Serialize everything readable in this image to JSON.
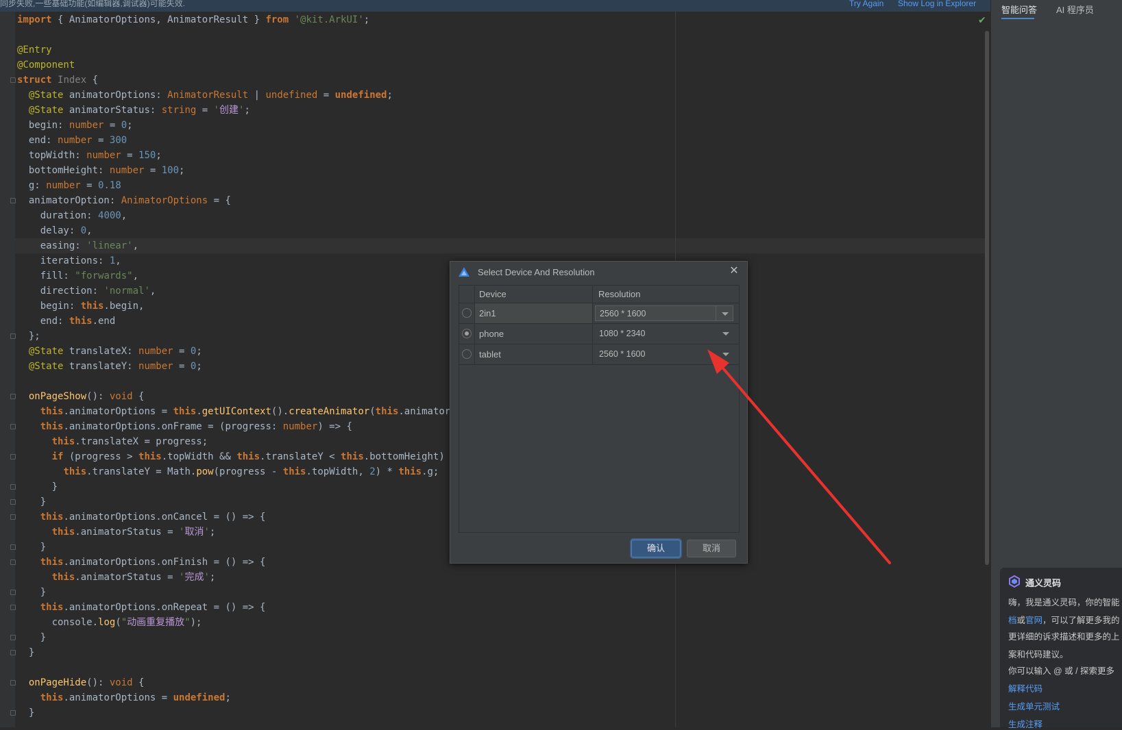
{
  "notification": {
    "text": "同步失败,一些基础功能(如编辑器,调试器)可能失效.",
    "try_again": "Try Again",
    "show_log": "Show Log in Explorer"
  },
  "editor": {
    "status_icon": "check-icon",
    "lines": [
      {
        "row": 0,
        "html": "<span class='kw'>import</span> { AnimatorOptions, AnimatorResult } <span class='kw'>from</span> <span class='str'>'@kit.ArkUI'</span>;"
      },
      {
        "row": 2,
        "html": "<span class='deco'>@Entry</span>"
      },
      {
        "row": 3,
        "html": "<span class='deco'>@Component</span>"
      },
      {
        "row": 4,
        "html": "<span class='kw'>struct</span> <span class='gray'>Index</span> {"
      },
      {
        "row": 5,
        "html": "  <span class='deco'>@State</span> animatorOptions: <span class='type'>AnimatorResult</span> | <span class='kwn'>undefined</span> = <span class='kw'>undefined</span>;"
      },
      {
        "row": 6,
        "html": "  <span class='deco'>@State</span> animatorStatus: <span class='kwn'>string</span> = <span class='str'>'<span class=\"purple\">创建</span>'</span>;"
      },
      {
        "row": 7,
        "html": "  begin: <span class='kwn'>number</span> = <span class='num'>0</span>;"
      },
      {
        "row": 8,
        "html": "  end: <span class='kwn'>number</span> = <span class='num'>300</span>"
      },
      {
        "row": 9,
        "html": "  topWidth: <span class='kwn'>number</span> = <span class='num'>150</span>;"
      },
      {
        "row": 10,
        "html": "  bottomHeight: <span class='kwn'>number</span> = <span class='num'>100</span>;"
      },
      {
        "row": 11,
        "html": "  g: <span class='kwn'>number</span> = <span class='num'>0.18</span>"
      },
      {
        "row": 12,
        "html": "  animatorOption: <span class='type'>AnimatorOptions</span> = {"
      },
      {
        "row": 13,
        "html": "    duration: <span class='num'>4000</span>,"
      },
      {
        "row": 14,
        "html": "    delay: <span class='num'>0</span>,"
      },
      {
        "row": 15,
        "html": "    easing: <span class='str'>'linear'</span>,"
      },
      {
        "row": 16,
        "html": "    iterations: <span class='num'>1</span>,"
      },
      {
        "row": 17,
        "html": "    fill: <span class='str'>\"forwards\"</span>,"
      },
      {
        "row": 18,
        "html": "    direction: <span class='str'>'normal'</span>,"
      },
      {
        "row": 19,
        "html": "    begin: <span class='kw'>this</span>.begin,"
      },
      {
        "row": 20,
        "html": "    end: <span class='kw'>this</span>.end"
      },
      {
        "row": 21,
        "html": "  };"
      },
      {
        "row": 22,
        "html": "  <span class='deco'>@State</span> translateX: <span class='kwn'>number</span> = <span class='num'>0</span>;"
      },
      {
        "row": 23,
        "html": "  <span class='deco'>@State</span> translateY: <span class='kwn'>number</span> = <span class='num'>0</span>;"
      },
      {
        "row": 25,
        "html": "  <span class='fn'>onPageShow</span>(): <span class='kwn'>void</span> {"
      },
      {
        "row": 26,
        "html": "    <span class='kw'>this</span>.animatorOptions = <span class='kw'>this</span>.<span class='fn'>getUIContext</span>().<span class='fn'>createAnimator</span>(<span class='kw'>this</span>.animatorOpti"
      },
      {
        "row": 27,
        "html": "    <span class='kw'>this</span>.animatorOptions.onFrame = (progress: <span class='kwn'>number</span>) => {"
      },
      {
        "row": 28,
        "html": "      <span class='kw'>this</span>.translateX = progress;"
      },
      {
        "row": 29,
        "html": "      <span class='kw'>if</span> (progress > <span class='kw'>this</span>.topWidth && <span class='kw'>this</span>.translateY < <span class='kw'>this</span>.bottomHeight) {"
      },
      {
        "row": 30,
        "html": "        <span class='kw'>this</span>.translateY = Math.<span class='fn'>pow</span>(progress - <span class='kw'>this</span>.topWidth, <span class='num'>2</span>) * <span class='kw'>this</span>.g;"
      },
      {
        "row": 31,
        "html": "      }"
      },
      {
        "row": 32,
        "html": "    }"
      },
      {
        "row": 33,
        "html": "    <span class='kw'>this</span>.animatorOptions.onCancel = () => {"
      },
      {
        "row": 34,
        "html": "      <span class='kw'>this</span>.animatorStatus = <span class='str'>'<span class=\"purple\">取消</span>'</span>;"
      },
      {
        "row": 35,
        "html": "    }"
      },
      {
        "row": 36,
        "html": "    <span class='kw'>this</span>.animatorOptions.onFinish = () => {"
      },
      {
        "row": 37,
        "html": "      <span class='kw'>this</span>.animatorStatus = <span class='str'>'<span class=\"purple\">完成</span>'</span>;"
      },
      {
        "row": 38,
        "html": "    }"
      },
      {
        "row": 39,
        "html": "    <span class='kw'>this</span>.animatorOptions.onRepeat = () => {"
      },
      {
        "row": 40,
        "html": "      console.<span class='fn'>log</span>(<span class='str'>\"<span class=\"purple\">动画重复播放</span>\"</span>);"
      },
      {
        "row": 41,
        "html": "    }"
      },
      {
        "row": 42,
        "html": "  }"
      },
      {
        "row": 44,
        "html": "  <span class='fn'>onPageHide</span>(): <span class='kwn'>void</span> {"
      },
      {
        "row": 45,
        "html": "    <span class='kw'>this</span>.animatorOptions = <span class='kw'>undefined</span>;"
      },
      {
        "row": 46,
        "html": "  }"
      }
    ],
    "fold_rows": [
      4,
      12,
      21,
      25,
      27,
      29,
      31,
      32,
      33,
      35,
      36,
      38,
      39,
      41,
      42,
      44,
      46
    ]
  },
  "right_panel": {
    "tabs": [
      "智能问答",
      "AI 程序员"
    ],
    "assistant": {
      "title": "通义灵码",
      "greeting": "嗨，我是通义灵码，你的智能",
      "line2_link1": "档",
      "line2_mid": "或",
      "line2_link2": "官网",
      "line2_rest": "，可以了解更多我的",
      "line3": "更详细的诉求描述和更多的上",
      "line4": "案和代码建议。",
      "line5": "你可以输入 @ 或 / 探索更多",
      "link_explain": "解释代码",
      "link_unit_test": "生成单元测试",
      "link_comment": "生成注释"
    }
  },
  "dialog": {
    "title": "Select Device And Resolution",
    "col_device": "Device",
    "col_resolution": "Resolution",
    "rows": [
      {
        "device": "2in1",
        "resolution": "2560 * 1600",
        "selected": false
      },
      {
        "device": "phone",
        "resolution": "1080 * 2340",
        "selected": true
      },
      {
        "device": "tablet",
        "resolution": "2560 * 1600",
        "selected": false
      }
    ],
    "ok_label": "确认",
    "cancel_label": "取消",
    "colors": {
      "ok_bg": "#365880",
      "annotation_arrow": "#e8322e"
    }
  }
}
